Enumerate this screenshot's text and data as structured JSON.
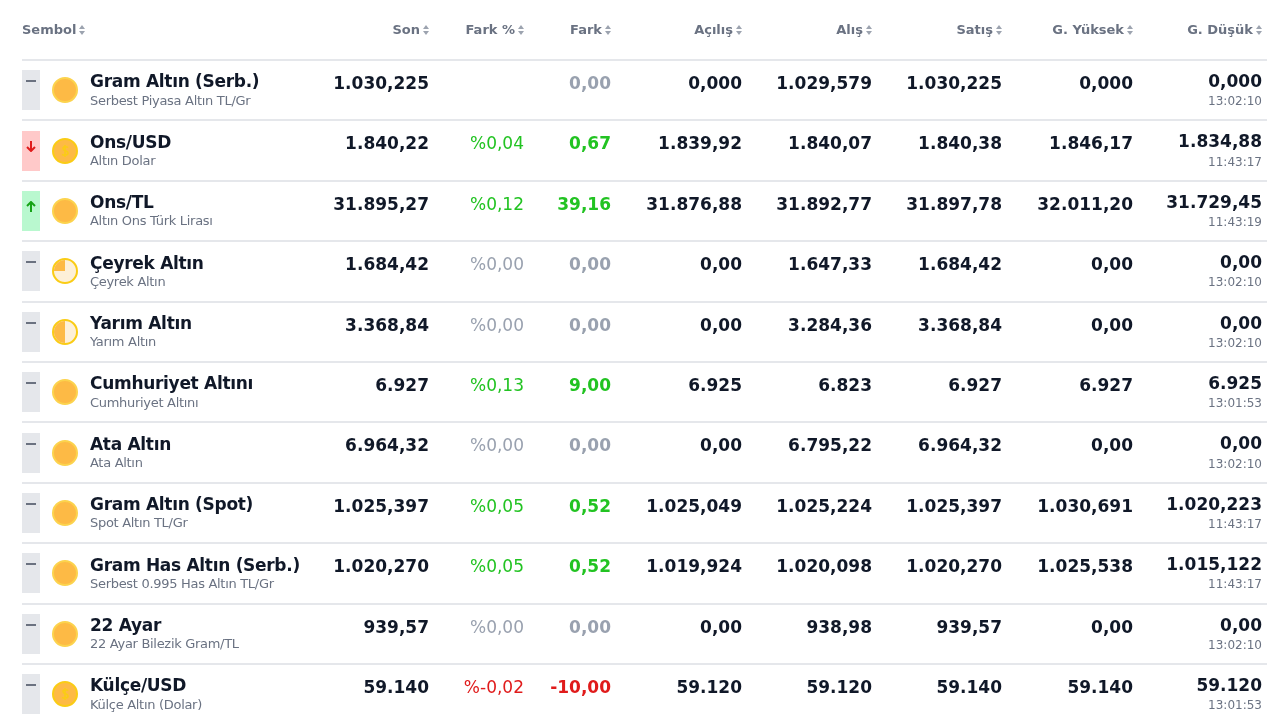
{
  "columns": [
    {
      "label": "Sembol"
    },
    {
      "label": "Son"
    },
    {
      "label": "Fark %"
    },
    {
      "label": "Fark"
    },
    {
      "label": "Açılış"
    },
    {
      "label": "Alış"
    },
    {
      "label": "Satış"
    },
    {
      "label": "G. Yüksek"
    },
    {
      "label": "G. Düşük"
    }
  ],
  "rows": [
    {
      "trend": {
        "kind": "flat"
      },
      "coin": {
        "kind": "full"
      },
      "name": "Gram Altın (Serb.)",
      "subtitle": "Serbest Piyasa Altın TL/Gr",
      "son": "1.030,225",
      "change": {
        "kind": "neutral"
      },
      "fark": "0,00",
      "acilis": "0,000",
      "alis": "1.029,579",
      "satis": "1.030,225",
      "yuksek": "0,000",
      "dusuk": "0,000",
      "time": "13:02:10"
    },
    {
      "trend": {
        "kind": "down"
      },
      "coin": {
        "kind": "dollar"
      },
      "name": "Ons/USD",
      "subtitle": "Altın Dolar",
      "son": "1.840,22",
      "change": {
        "kind": "positive"
      },
      "fark_pct": "%0,04",
      "fark": "0,67",
      "acilis": "1.839,92",
      "alis": "1.840,07",
      "satis": "1.840,38",
      "yuksek": "1.846,17",
      "dusuk": "1.834,88",
      "time": "11:43:17"
    },
    {
      "trend": {
        "kind": "up"
      },
      "coin": {
        "kind": "full"
      },
      "name": "Ons/TL",
      "subtitle": "Altın Ons Türk Lirası",
      "son": "31.895,27",
      "change": {
        "kind": "positive"
      },
      "fark_pct": "%0,12",
      "fark": "39,16",
      "acilis": "31.876,88",
      "alis": "31.892,77",
      "satis": "31.897,78",
      "yuksek": "32.011,20",
      "dusuk": "31.729,45",
      "time": "11:43:19"
    },
    {
      "trend": {
        "kind": "flat"
      },
      "coin": {
        "kind": "quarter"
      },
      "name": "Çeyrek Altın",
      "subtitle": "Çeyrek Altın",
      "son": "1.684,42",
      "change": {
        "kind": "neutral"
      },
      "fark_pct": "%0,00",
      "fark": "0,00",
      "acilis": "0,00",
      "alis": "1.647,33",
      "satis": "1.684,42",
      "yuksek": "0,00",
      "dusuk": "0,00",
      "time": "13:02:10"
    },
    {
      "trend": {
        "kind": "flat"
      },
      "coin": {
        "kind": "half"
      },
      "name": "Yarım Altın",
      "subtitle": "Yarım Altın",
      "son": "3.368,84",
      "change": {
        "kind": "neutral"
      },
      "fark_pct": "%0,00",
      "fark": "0,00",
      "acilis": "0,00",
      "alis": "3.284,36",
      "satis": "3.368,84",
      "yuksek": "0,00",
      "dusuk": "0,00",
      "time": "13:02:10"
    },
    {
      "trend": {
        "kind": "flat"
      },
      "coin": {
        "kind": "full"
      },
      "name": "Cumhuriyet Altını",
      "subtitle": "Cumhuriyet Altını",
      "son": "6.927",
      "change": {
        "kind": "positive"
      },
      "fark_pct": "%0,13",
      "fark": "9,00",
      "acilis": "6.925",
      "alis": "6.823",
      "satis": "6.927",
      "yuksek": "6.927",
      "dusuk": "6.925",
      "time": "13:01:53"
    },
    {
      "trend": {
        "kind": "flat"
      },
      "coin": {
        "kind": "full"
      },
      "name": "Ata Altın",
      "subtitle": "Ata Altın",
      "son": "6.964,32",
      "change": {
        "kind": "neutral"
      },
      "fark_pct": "%0,00",
      "fark": "0,00",
      "acilis": "0,00",
      "alis": "6.795,22",
      "satis": "6.964,32",
      "yuksek": "0,00",
      "dusuk": "0,00",
      "time": "13:02:10"
    },
    {
      "trend": {
        "kind": "flat"
      },
      "coin": {
        "kind": "full"
      },
      "name": "Gram Altın (Spot)",
      "subtitle": "Spot Altın TL/Gr",
      "son": "1.025,397",
      "change": {
        "kind": "positive"
      },
      "fark_pct": "%0,05",
      "fark": "0,52",
      "acilis": "1.025,049",
      "alis": "1.025,224",
      "satis": "1.025,397",
      "yuksek": "1.030,691",
      "dusuk": "1.020,223",
      "time": "11:43:17"
    },
    {
      "trend": {
        "kind": "flat"
      },
      "coin": {
        "kind": "full"
      },
      "name": "Gram Has Altın (Serb.)",
      "subtitle": "Serbest 0.995 Has Altın TL/Gr",
      "son": "1.020,270",
      "change": {
        "kind": "positive"
      },
      "fark_pct": "%0,05",
      "fark": "0,52",
      "acilis": "1.019,924",
      "alis": "1.020,098",
      "satis": "1.020,270",
      "yuksek": "1.025,538",
      "dusuk": "1.015,122",
      "time": "11:43:17"
    },
    {
      "trend": {
        "kind": "flat"
      },
      "coin": {
        "kind": "full"
      },
      "name": "22 Ayar",
      "subtitle": "22 Ayar Bilezik Gram/TL",
      "son": "939,57",
      "change": {
        "kind": "neutral"
      },
      "fark_pct": "%0,00",
      "fark": "0,00",
      "acilis": "0,00",
      "alis": "938,98",
      "satis": "939,57",
      "yuksek": "0,00",
      "dusuk": "0,00",
      "time": "13:02:10"
    },
    {
      "trend": {
        "kind": "flat"
      },
      "coin": {
        "kind": "dollar"
      },
      "name": "Külçe/USD",
      "subtitle": "Külçe Altın (Dolar)",
      "son": "59.140",
      "change": {
        "kind": "negative"
      },
      "fark_pct": "%-0,02",
      "fark": "-10,00",
      "acilis": "59.120",
      "alis": "59.120",
      "satis": "59.140",
      "yuksek": "59.140",
      "dusuk": "59.120",
      "time": "13:01:53"
    }
  ]
}
